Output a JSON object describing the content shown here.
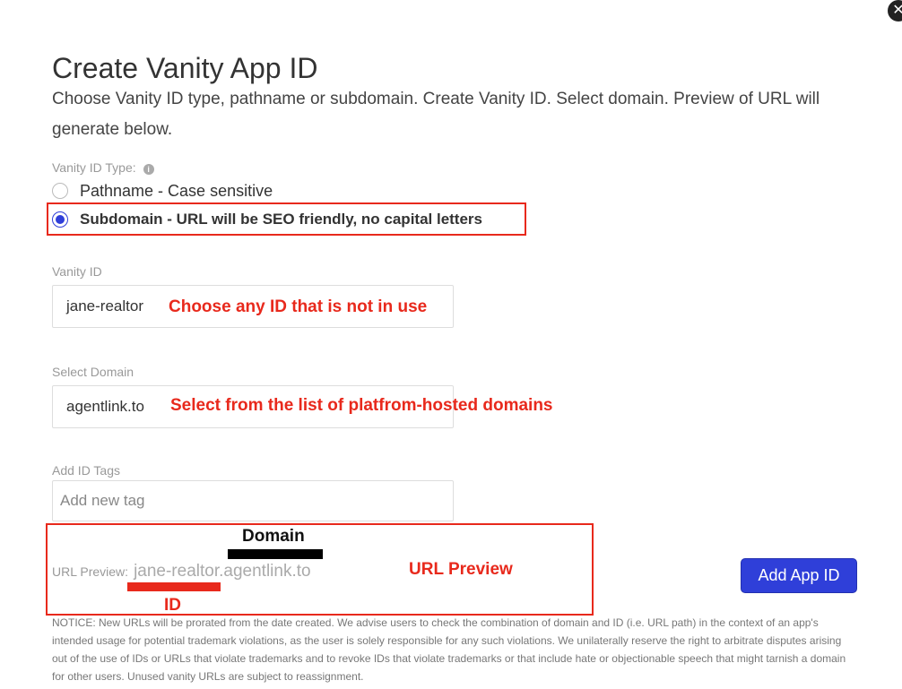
{
  "dialog": {
    "close_glyph": "✕",
    "title": "Create Vanity App ID",
    "description": "Choose Vanity ID type, pathname or subdomain. Create Vanity ID. Select domain. Preview of URL will generate below."
  },
  "vanity_type": {
    "label": "Vanity ID Type:",
    "info_glyph": "i",
    "options": [
      {
        "label": "Pathname - Case sensitive",
        "selected": false
      },
      {
        "label": "Subdomain - URL will be SEO friendly, no capital letters",
        "selected": true
      }
    ]
  },
  "vanity_id": {
    "label": "Vanity ID",
    "value": "jane-realtor",
    "annotation": "Choose any ID that is not in use"
  },
  "domain": {
    "label": "Select Domain",
    "value": "agentlink.to",
    "annotation": "Select from the list of platfrom-hosted domains"
  },
  "tags": {
    "label": "Add ID Tags",
    "placeholder": "Add new tag"
  },
  "url_preview": {
    "label": "URL Preview:",
    "value": "jane-realtor.agentlink.to",
    "annotation_domain": "Domain",
    "annotation_id": "ID",
    "annotation_preview": "URL Preview"
  },
  "actions": {
    "add_label": "Add App ID"
  },
  "notice": "NOTICE: New URLs will be prorated from the date created. We advise users to check the combination of domain and ID (i.e. URL path) in the context of an app's intended usage for potential trademark violations, as the user is solely responsible for any such violations. We unilaterally reserve the right to arbitrate disputes arising out of the use of IDs or URLs that violate trademarks and to revoke IDs that violate trademarks or that include hate or objectionable speech that might tarnish a domain for other users. Unused vanity URLs are subject to reassignment.",
  "colors": {
    "accent": "#2f3fd9",
    "annotation": "#e8291c"
  }
}
